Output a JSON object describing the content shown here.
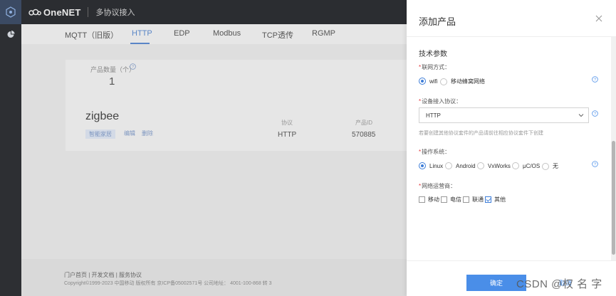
{
  "topbar": {
    "brand": "OneNET",
    "section": "多协议接入"
  },
  "tabs": [
    {
      "label": "MQTT（旧版）"
    },
    {
      "label": "HTTP"
    },
    {
      "label": "EDP"
    },
    {
      "label": "Modbus"
    },
    {
      "label": "TCP透传"
    },
    {
      "label": "RGMP"
    }
  ],
  "stats": {
    "count_label": "产品数量（个）",
    "count_value": "1"
  },
  "product": {
    "name": "zigbee",
    "tag": "智能家居",
    "edit": "编辑",
    "delete": "删除",
    "protocol_header": "协议",
    "protocol_value": "HTTP",
    "id_header": "产品ID",
    "id_value": "570885"
  },
  "footer": {
    "links": "门户首页 | 开发文档 | 服务协议",
    "copyright": "Copyright©1999-2023 中国移动 版权所有 京ICP备05002571号 公司地址：  4001-100-868 转 3"
  },
  "drawer": {
    "title": "添加产品",
    "section_title": "技术参数",
    "network": {
      "label": "联网方式：",
      "options": [
        {
          "label": "wifi"
        },
        {
          "label": "移动蜂窝网络"
        }
      ]
    },
    "protocol": {
      "label": "设备接入协议：",
      "value": "HTTP",
      "hint": "若要创建其他协议套件的产品请前往相应协议套件下创建"
    },
    "os": {
      "label": "操作系统：",
      "options": [
        {
          "label": "Linux"
        },
        {
          "label": "Android"
        },
        {
          "label": "VxWorks"
        },
        {
          "label": "μC/OS"
        },
        {
          "label": "无"
        }
      ]
    },
    "carrier": {
      "label": "网络运营商：",
      "options": [
        {
          "label": "移动"
        },
        {
          "label": "电信"
        },
        {
          "label": "联通"
        },
        {
          "label": "其他"
        }
      ]
    },
    "ok": "确定",
    "cancel": "取消"
  },
  "watermark": "CSDN @权 名 字",
  "colors": {
    "accent": "#4a8ee8",
    "required": "#e3373b",
    "topbar": "#2b2d31"
  }
}
